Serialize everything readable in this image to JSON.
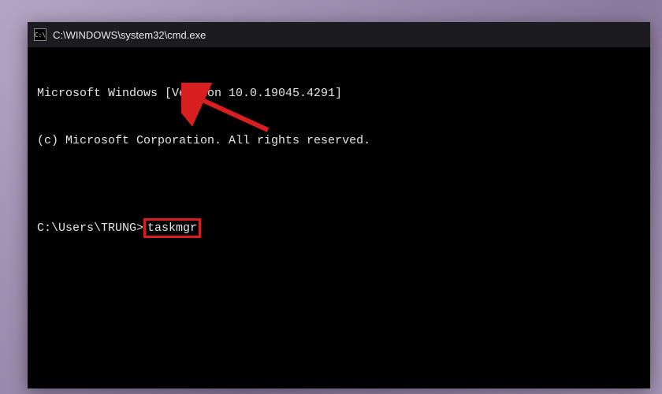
{
  "window": {
    "title": "C:\\WINDOWS\\system32\\cmd.exe",
    "icon_label": "C:\\"
  },
  "terminal": {
    "line1": "Microsoft Windows [Version 10.0.19045.4291]",
    "line2": "(c) Microsoft Corporation. All rights reserved.",
    "blank": "",
    "prompt": "C:\\Users\\TRUNG>",
    "command": "taskmgr"
  },
  "annotation": {
    "color": "#d81f1f"
  }
}
